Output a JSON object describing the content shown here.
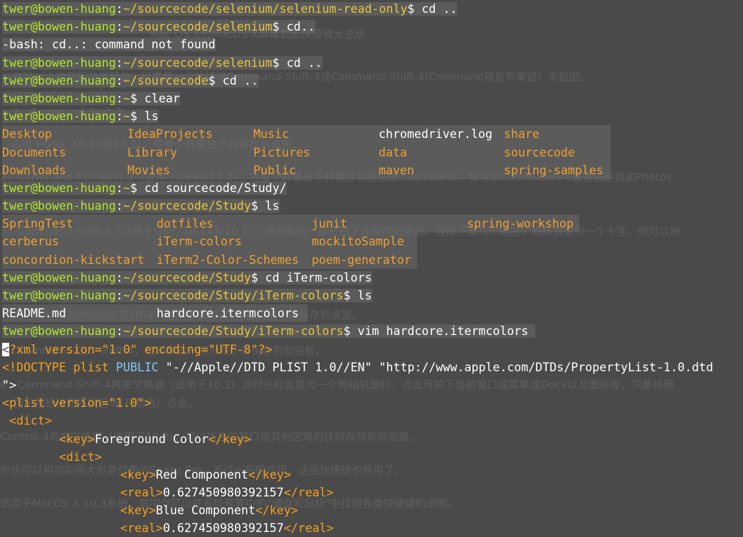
{
  "prompt": {
    "user": "twer@bowen-huang"
  },
  "lines": [
    {
      "type": "prompt",
      "path": "~/sourcecode/selenium/selenium-read-only",
      "cmd": "cd .."
    },
    {
      "type": "prompt",
      "path": "~/sourcecode/selenium",
      "cmd": "cd.."
    },
    {
      "type": "text",
      "text": "-bash: cd..: command not found"
    },
    {
      "type": "prompt",
      "path": "~/sourcecode/selenium",
      "cmd": "cd .."
    },
    {
      "type": "prompt",
      "path": "~/sourcecode",
      "cmd": "cd .."
    },
    {
      "type": "prompt",
      "path": "~",
      "cmd": "clear"
    },
    {
      "type": "prompt",
      "path": "~",
      "cmd": "ls"
    }
  ],
  "ls_home": {
    "rows": [
      [
        "Desktop",
        "IdeaProjects",
        "Music",
        "chromedriver.log",
        "share"
      ],
      [
        "Documents",
        "Library",
        "Pictures",
        "data",
        "sourcecode"
      ],
      [
        "Downloads",
        "Movies",
        "Public",
        "maven",
        "spring-samples"
      ]
    ]
  },
  "lines2": [
    {
      "type": "prompt",
      "path": "~",
      "cmd": "cd sourcecode/Study/"
    },
    {
      "type": "prompt",
      "path": "~/sourcecode/Study",
      "cmd": "ls"
    }
  ],
  "ls_study": {
    "rows": [
      [
        "SpringTest",
        "dotfiles",
        "junit",
        "spring-workshop"
      ],
      [
        "cerberus",
        "iTerm-colors",
        "mockitoSample",
        ""
      ],
      [
        "concordion-kickstart",
        "iTerm2-Color-Schemes",
        "poem-generator",
        ""
      ]
    ]
  },
  "lines3": [
    {
      "type": "prompt",
      "path": "~/sourcecode/Study",
      "cmd": "cd iTerm-colors"
    },
    {
      "type": "prompt",
      "path": "~/sourcecode/Study/iTerm-colors",
      "cmd": "ls"
    }
  ],
  "ls_iterm": {
    "rows": [
      [
        "README.md",
        "hardcore.itermcolors"
      ]
    ]
  },
  "lines4": [
    {
      "type": "prompt",
      "path": "~/sourcecode/Study/iTerm-colors",
      "cmd": "vim hardcore.itermcolors"
    }
  ],
  "vim": {
    "cursor_char": "<",
    "xml_decl_rest": "?xml version=\"1.0\" encoding=\"UTF-8\"?>",
    "doctype_open": "<!DOCTYPE",
    "doctype_plist": " plist ",
    "doctype_public": "PUBLIC",
    "doctype_str1": " \"-//Apple//DTD PLIST 1.0//EN\" \"http://www.apple.com/DTDs/PropertyList-1.0.dtd",
    "doctype_close": "\">",
    "plist_open": "<plist version=\"1.0\">",
    "dict_open": "<dict>",
    "key_fg_open": "<key>",
    "key_fg_text": "Foreground Color",
    "key_fg_close": "</key>",
    "inner_dict_open": "<dict>",
    "red_key_open": "<key>",
    "red_key_text": "Red Component",
    "red_key_close": "</key>",
    "red_real_open": "<real>",
    "red_real_val": "0.627450980392157",
    "red_real_close": "</real>",
    "blue_key_open": "<key>",
    "blue_key_text": "Blue Component",
    "blue_key_close": "</key>",
    "blue_real_open": "<real>",
    "blue_real_val": "0.627450980392157",
    "blue_real_close": "</real>"
  },
  "ghost_text": [
    "Mac OS X的MacOS X屏幕截图快捷键大总结",
    "在Mac上的截图非常简单，只需要一个快捷键Command-Shift-3或Command-Shift-4(Command就是苹果键）来截图。",
    "1、Command-Shift-3",
    "（适用于OS9, 10.1X和10.2）：将整个屏幕拍下并保存到桌面。",
    "2、Command-Ctrl-Shift-3（适用于OS9和10.2）：将整个屏幕拍下并保存到剪贴板(Clipboard)，你可以Command+V直接粘贴到如Photos",
    "3、Command-Shift-4（适用于OS9, 10.1X和10.2）：将屏幕的一部分拍下并保存到桌面。当按下着几个键后，光标会变为一个十字，你可以拖",
    "4、Command-Shift-4（适用于OS9）：将窗口拍下并保存到桌面。",
    "5、Command-Ctrl-Shift-4，将屏幕的一部分拍下并保存到剪贴板。",
    "6、Command-Shift-4再按空格键（适用于10.2）这时光标会变为一个照相机图标，点击可拍下当前窗口或菜单或Dock以及图标等，只要将照",
    "相机图标移到不同区域(有颜色）点击。",
    "Control-4再按空格键（适用于10.2），可以将当前窗口或其他区域的快照保存到剪贴板。",
    "你也可以用功能强大但要付费的Snapz Pro，不过一般的应用，这些快捷键也够用了。",
    "适用于MacOS X 10.3系统，其中你可以在系统预置中的\"键盘和鼠标\"中找到各类快捷键的说明。"
  ]
}
